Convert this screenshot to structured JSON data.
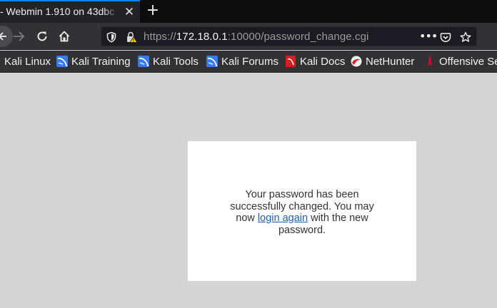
{
  "tab": {
    "title": "- Webmin 1.910 on 43dbc"
  },
  "address_bar": {
    "url_scheme": "https://",
    "url_host": "172.18.0.1",
    "url_rest": ":10000/password_change.cgi"
  },
  "bookmarks": [
    {
      "label": "Kali Linux",
      "icon": "kali-icon"
    },
    {
      "label": "Kali Training",
      "icon": "kali-icon"
    },
    {
      "label": "Kali Tools",
      "icon": "kali-icon"
    },
    {
      "label": "Kali Forums",
      "icon": "kali-icon"
    },
    {
      "label": "Kali Docs",
      "icon": "docs-icon"
    },
    {
      "label": "NetHunter",
      "icon": "nethunter-icon"
    },
    {
      "label": "Offensive Se",
      "icon": "offsec-icon"
    }
  ],
  "content": {
    "message_before": "Your password has been successfully changed. You may now ",
    "link_text": "login again",
    "message_after": " with the new password."
  },
  "colors": {
    "page_background": "#d5d5d5",
    "link": "#1a5fb4",
    "tab_accent": "#0a84ff"
  }
}
